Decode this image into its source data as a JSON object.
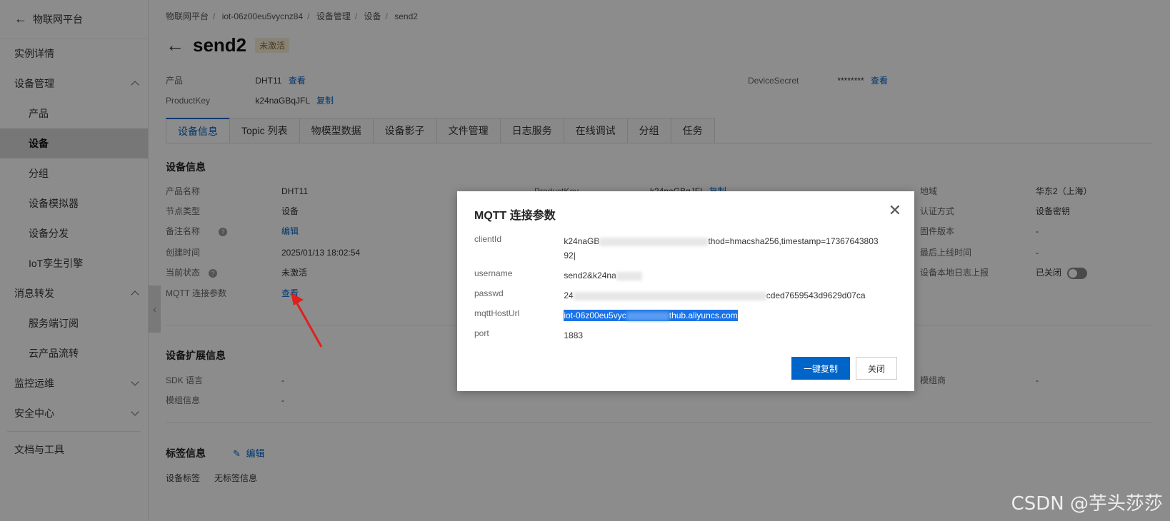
{
  "sidebar": {
    "back_label": "物联网平台",
    "items": [
      {
        "label": "实例详情"
      },
      {
        "label": "设备管理"
      },
      {
        "label": "产品"
      },
      {
        "label": "设备"
      },
      {
        "label": "分组"
      },
      {
        "label": "设备模拟器"
      },
      {
        "label": "设备分发"
      },
      {
        "label": "IoT孪生引擎"
      },
      {
        "label": "消息转发"
      },
      {
        "label": "服务端订阅"
      },
      {
        "label": "云产品流转"
      },
      {
        "label": "监控运维"
      },
      {
        "label": "安全中心"
      },
      {
        "label": "文档与工具"
      }
    ]
  },
  "breadcrumb": [
    "物联网平台",
    "iot-06z00eu5vycnz84",
    "设备管理",
    "设备",
    "send2"
  ],
  "header": {
    "title": "send2",
    "status_badge": "未激活",
    "product_label": "产品",
    "product_value": "DHT11",
    "product_link": "查看",
    "productkey_label": "ProductKey",
    "productkey_value": "k24naGBqJFL",
    "productkey_link": "复制",
    "secret_label": "DeviceSecret",
    "secret_value": "********",
    "secret_link": "查看"
  },
  "tabs": [
    "设备信息",
    "Topic 列表",
    "物模型数据",
    "设备影子",
    "文件管理",
    "日志服务",
    "在线调试",
    "分组",
    "任务"
  ],
  "device_info": {
    "title": "设备信息",
    "left": [
      {
        "k": "产品名称",
        "v": "DHT11"
      },
      {
        "k": "节点类型",
        "v": "设备"
      },
      {
        "k": "备注名称",
        "v": "编辑"
      },
      {
        "k": "创建时间",
        "v": "2025/01/13 18:02:54"
      },
      {
        "k": "当前状态",
        "v": "未激活"
      },
      {
        "k": "MQTT 连接参数",
        "v": "查看"
      }
    ],
    "mid": [
      {
        "k": "ProductKey",
        "v": "k24naGBqJFL",
        "link": "复制"
      }
    ],
    "right": [
      {
        "k": "地域",
        "v": "华东2（上海）"
      },
      {
        "k": "认证方式",
        "v": "设备密钥"
      },
      {
        "k": "固件版本",
        "v": "-"
      },
      {
        "k": "最后上线时间",
        "v": "-"
      },
      {
        "k": "设备本地日志上报",
        "v": "已关闭"
      }
    ]
  },
  "ext_info": {
    "title": "设备扩展信息",
    "rows": [
      {
        "k": "SDK 语言",
        "v": "-"
      },
      {
        "k": "模组信息",
        "v": "-"
      }
    ],
    "right_k": "模组商",
    "right_v": "-"
  },
  "tag_info": {
    "title": "标签信息",
    "edit": "编辑",
    "k": "设备标签",
    "v": "无标签信息"
  },
  "modal": {
    "title": "MQTT 连接参数",
    "client_id_label": "clientId",
    "client_id_start": "k24naGB",
    "client_id_mid": "thod=hmacsha256,timestamp=17367643803",
    "client_id_end": "92|",
    "username_label": "username",
    "username_value": "send2&k24na",
    "passwd_label": "passwd",
    "passwd_start": "24",
    "passwd_end": "cded7659543d9629d07ca",
    "host_label": "mqttHostUrl",
    "host_start": "iot-06z00eu5vyc",
    "host_end": "thub.aliyuncs.com",
    "port_label": "port",
    "port_value": "1883",
    "copy_button": "一键复制",
    "close_button": "关闭"
  },
  "watermark": "CSDN @芋头莎莎"
}
